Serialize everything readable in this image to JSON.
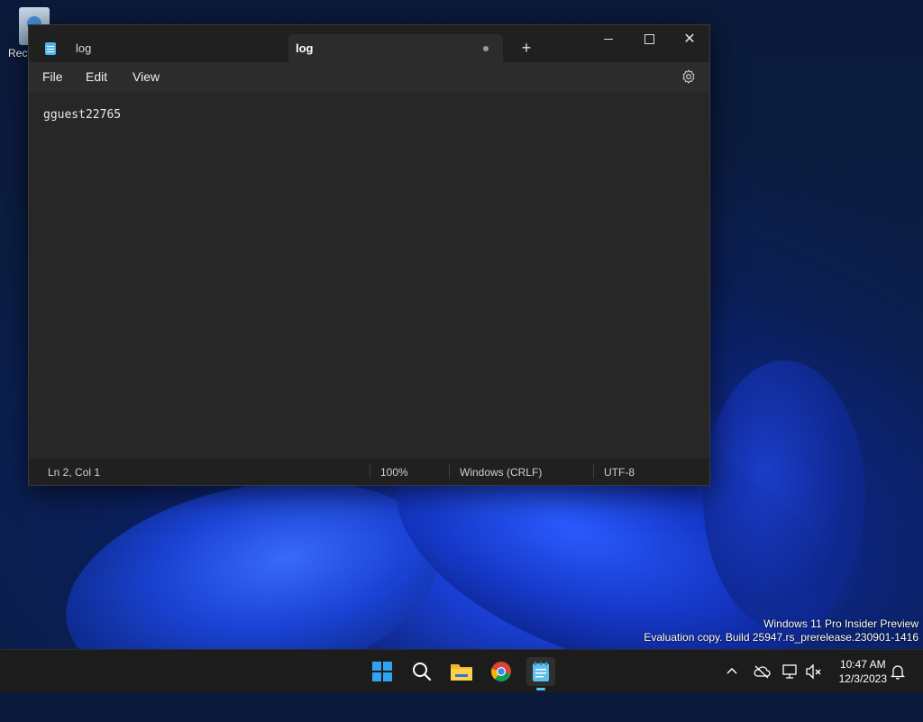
{
  "desktop": {
    "recycle_bin_label": "Recy"
  },
  "window": {
    "tabs": [
      {
        "label": "log",
        "active": false
      },
      {
        "label": "log",
        "active": true,
        "unsaved_dot": true
      }
    ],
    "new_tab_symbol": "+",
    "menu": {
      "file": "File",
      "edit": "Edit",
      "view": "View"
    },
    "content": "gguest22765",
    "status": {
      "position": "Ln 2, Col 1",
      "zoom": "100%",
      "line_ending": "Windows (CRLF)",
      "encoding": "UTF-8"
    },
    "close_symbol": "✕"
  },
  "watermark": {
    "line1": "Windows 11 Pro Insider Preview",
    "line2": "Evaluation copy. Build 25947.rs_prerelease.230901-1416"
  },
  "taskbar": {
    "apps": [
      "start-icon",
      "search-icon",
      "file-explorer-icon",
      "chrome-icon",
      "notepad-icon"
    ],
    "tray_icons": [
      "chevron-up-icon",
      "onedrive-icon",
      "network-icon",
      "volume-muted-icon",
      "notification-bell-icon"
    ],
    "time": "10:47 AM",
    "date": "12/3/2023"
  },
  "colors": {
    "accent": "#4cc2ff",
    "window_bg": "#272727",
    "titlebar_bg": "#202020"
  }
}
